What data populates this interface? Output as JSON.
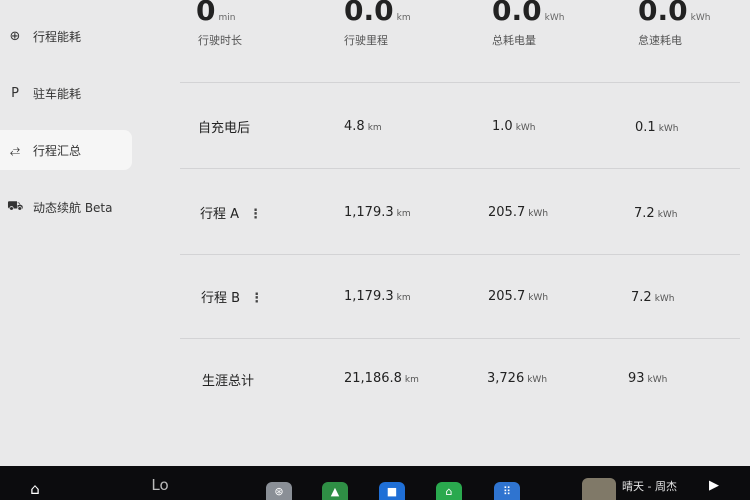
{
  "sidebar": {
    "items": [
      {
        "icon": "⊕",
        "icon_name": "trip-energy-icon",
        "label": "行程能耗"
      },
      {
        "icon": "P",
        "icon_name": "parking-icon",
        "label": "驻车能耗"
      },
      {
        "icon": "⥄",
        "icon_name": "trip-summary-icon",
        "label": "行程汇总"
      },
      {
        "icon": "⛟",
        "icon_name": "car-icon",
        "label": "动态续航 Beta"
      }
    ],
    "active_index": 2
  },
  "summary": [
    {
      "value": "0",
      "unit": "min",
      "caption": "行驶时长"
    },
    {
      "value": "0.0",
      "unit": "km",
      "caption": "行驶里程"
    },
    {
      "value": "0.0",
      "unit": "kWh",
      "caption": "总耗电量"
    },
    {
      "value": "0.0",
      "unit": "kWh",
      "caption": "怠速耗电"
    }
  ],
  "rows": [
    {
      "label": "自充电后",
      "more": "",
      "distance": "4.8",
      "distance_unit": "km",
      "energy": "1.0",
      "energy_unit": "kWh",
      "idle": "0.1",
      "idle_unit": "kWh"
    },
    {
      "label": "行程 A",
      "more": "⋮",
      "distance": "1,179.3",
      "distance_unit": "km",
      "energy": "205.7",
      "energy_unit": "kWh",
      "idle": "7.2",
      "idle_unit": "kWh"
    },
    {
      "label": "行程 B",
      "more": "⋮",
      "distance": "1,179.3",
      "distance_unit": "km",
      "energy": "205.7",
      "energy_unit": "kWh",
      "idle": "7.2",
      "idle_unit": "kWh"
    },
    {
      "label": "生涯总计",
      "more": "",
      "distance": "21,186.8",
      "distance_unit": "km",
      "energy": "3,726",
      "energy_unit": "kWh",
      "idle": "93",
      "idle_unit": "kWh"
    }
  ],
  "taskbar": {
    "home_icon": "⌂",
    "logo_text": "Lo",
    "weather_text": "晴天 - 周杰",
    "play_icon": "▶",
    "apps": [
      {
        "icon": "⊛",
        "name": "steering-wheel-icon",
        "color": "#8a8f96"
      },
      {
        "icon": "▲",
        "name": "navigation-icon",
        "color": "#2f8f45"
      },
      {
        "icon": "■",
        "name": "video-camera-icon",
        "color": "#1f6fd6"
      },
      {
        "icon": "⌂",
        "name": "seat-icon",
        "color": "#2aa94e"
      },
      {
        "icon": "⠿",
        "name": "app-grid-icon",
        "color": "#2f74d0"
      }
    ]
  }
}
